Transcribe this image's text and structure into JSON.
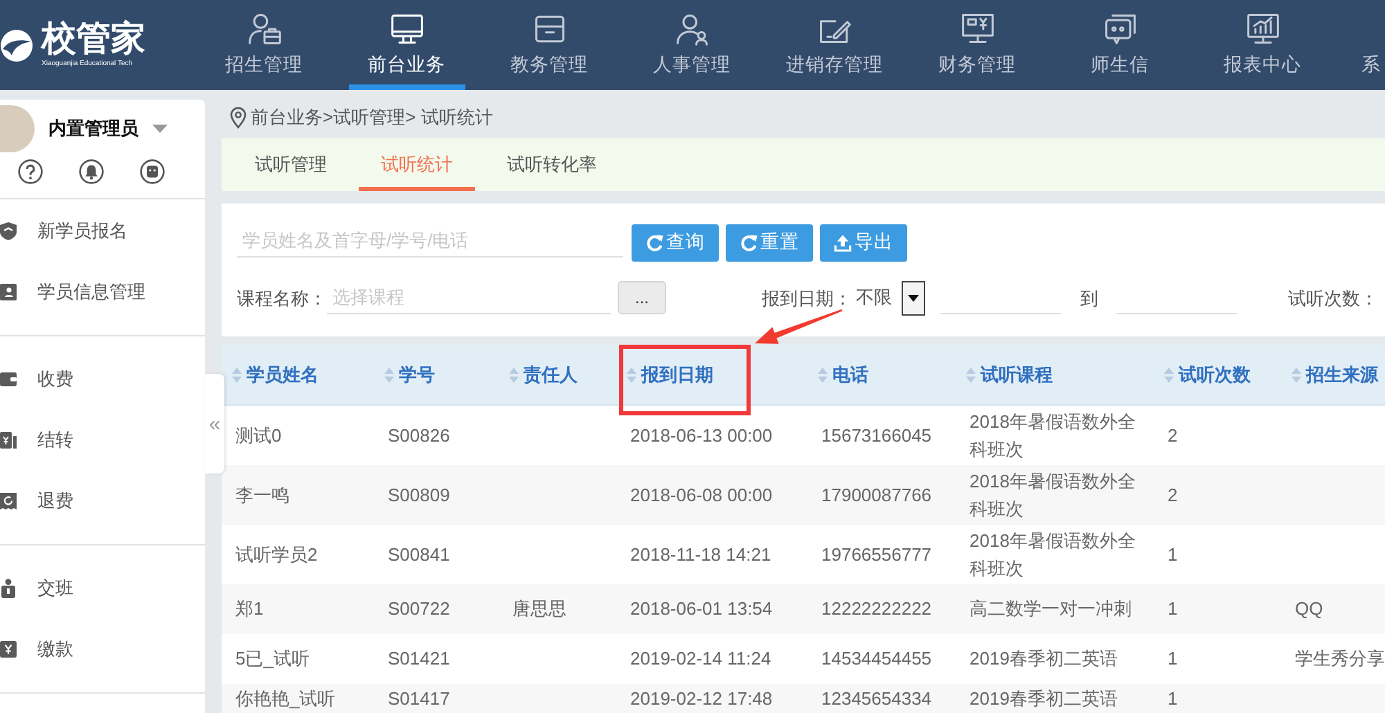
{
  "logo": {
    "name": "校管家",
    "tagline": "Xiaoguanjia Educational Tech"
  },
  "top_nav": [
    {
      "label": "招生管理",
      "selected": false
    },
    {
      "label": "前台业务",
      "selected": true
    },
    {
      "label": "教务管理",
      "selected": false
    },
    {
      "label": "人事管理",
      "selected": false
    },
    {
      "label": "进销存管理",
      "selected": false
    },
    {
      "label": "财务管理",
      "selected": false
    },
    {
      "label": "师生信",
      "selected": false
    },
    {
      "label": "报表中心",
      "selected": false
    },
    {
      "label": "系",
      "selected": false
    }
  ],
  "sidebar": {
    "user": "内置管理员",
    "groups": [
      {
        "items": [
          {
            "label": "新学员报名"
          },
          {
            "label": "学员信息管理"
          }
        ]
      },
      {
        "items": [
          {
            "label": "收费"
          },
          {
            "label": "结转"
          },
          {
            "label": "退费"
          }
        ]
      },
      {
        "items": [
          {
            "label": "交班"
          },
          {
            "label": "缴款"
          }
        ]
      }
    ],
    "collapse_handle": "«"
  },
  "breadcrumb": "前台业务>试听管理> 试听统计",
  "tabs": [
    {
      "label": "试听管理",
      "selected": false
    },
    {
      "label": "试听统计",
      "selected": true
    },
    {
      "label": "试听转化率",
      "selected": false
    }
  ],
  "filters": {
    "search": {
      "placeholder": "学员姓名及首字母/学号/电话"
    },
    "buttons": [
      "查询",
      "重置",
      "导出"
    ],
    "course": {
      "label": "课程名称：",
      "placeholder": "选择课程",
      "picker": "..."
    },
    "date": {
      "label": "报到日期：",
      "value": "不限",
      "to": "到"
    },
    "trial_count": {
      "label": "试听次数："
    }
  },
  "table": {
    "columns": [
      {
        "label": "学员姓名",
        "highlighted": false
      },
      {
        "label": "学号",
        "highlighted": false
      },
      {
        "label": "责任人",
        "highlighted": false
      },
      {
        "label": "报到日期",
        "highlighted": true
      },
      {
        "label": "电话",
        "highlighted": false
      },
      {
        "label": "试听课程",
        "highlighted": false
      },
      {
        "label": "试听次数",
        "highlighted": false
      },
      {
        "label": "招生来源",
        "highlighted": false
      }
    ],
    "rows": [
      {
        "name": "测试0",
        "student_no": "S00826",
        "date": "2018-06-13 00:00",
        "phone": "15673166045",
        "course": "2018年暑假语数外全科班次",
        "count": "2"
      },
      {
        "name": "李一鸣",
        "student_no": "S00809",
        "date": "2018-06-08 00:00",
        "phone": "17900087766",
        "course": "2018年暑假语数外全科班次",
        "count": "2"
      },
      {
        "name": "试听学员2",
        "student_no": "S00841",
        "date": "2018-11-18 14:21",
        "phone": "19766556777",
        "course": "2018年暑假语数外全科班次",
        "count": "1"
      },
      {
        "name": "郑1",
        "student_no": "S00722",
        "owner": "唐思思",
        "date": "2018-06-01 13:54",
        "phone": "12222222222",
        "course": "高二数学一对一冲刺",
        "count": "1",
        "source": "QQ"
      },
      {
        "name": "5已_试听",
        "student_no": "S01421",
        "date": "2019-02-14 11:24",
        "phone": "14534454455",
        "course": "2019春季初二英语",
        "count": "1",
        "source": "学生秀分享"
      },
      {
        "name": "你艳艳_试听",
        "student_no": "S01417",
        "date": "2019-02-12 17:48",
        "phone": "12345654334",
        "course": "2019春季初二英语",
        "count": "1"
      }
    ]
  }
}
